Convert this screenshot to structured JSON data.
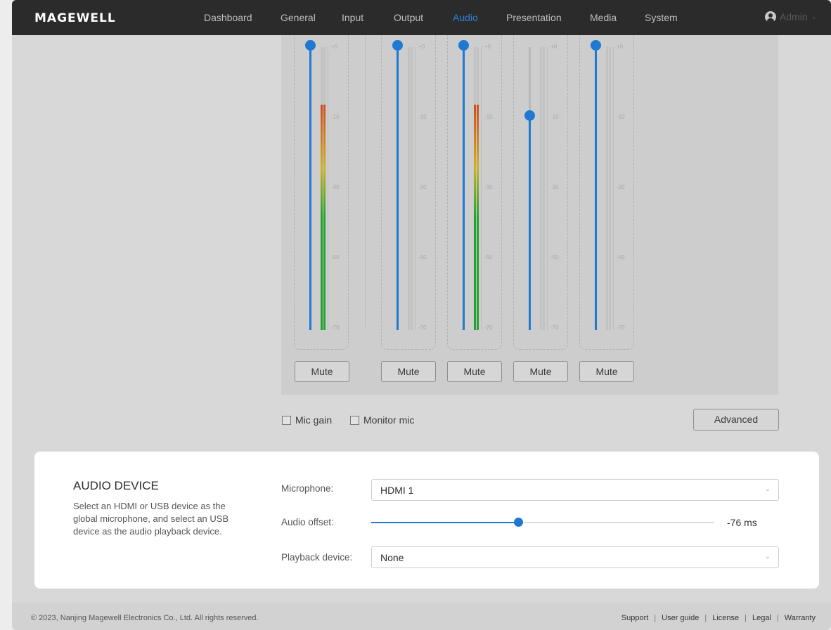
{
  "brand": {
    "logo_text": "MAGEWELL"
  },
  "nav": {
    "items": [
      {
        "label": "Dashboard"
      },
      {
        "label": "General"
      },
      {
        "label": "Input"
      },
      {
        "label": "Output"
      },
      {
        "label": "Audio",
        "active": true
      },
      {
        "label": "Presentation"
      },
      {
        "label": "Media"
      },
      {
        "label": "System"
      }
    ],
    "user": {
      "label": "Admin",
      "icon": "user-icon"
    }
  },
  "mixer": {
    "scale_labels": [
      "+0",
      "-10",
      "-30",
      "-50",
      "-70"
    ],
    "channels": [
      {
        "fader_level_db": 0,
        "meter_level_db": -10,
        "mute_label": "Mute"
      },
      {
        "fader_level_db": 0,
        "meter_level_db": null,
        "mute_label": "Mute"
      },
      {
        "fader_level_db": 0,
        "meter_level_db": -10,
        "mute_label": "Mute"
      },
      {
        "fader_level_db": -10,
        "meter_level_db": null,
        "mute_label": "Mute"
      },
      {
        "fader_level_db": 0,
        "meter_level_db": null,
        "mute_label": "Mute"
      }
    ],
    "mic_gain_label": "Mic gain",
    "mic_gain_checked": false,
    "monitor_mic_label": "Monitor mic",
    "monitor_mic_checked": false,
    "advanced_label": "Advanced"
  },
  "audio_device": {
    "title": "AUDIO DEVICE",
    "description": "Select an HDMI or USB device as the global microphone, and select an USB device as the audio playback device.",
    "microphone_label": "Microphone:",
    "microphone_value": "HDMI 1",
    "offset_label": "Audio offset:",
    "offset_value": "-76 ms",
    "offset_fraction": 0.43,
    "playback_label": "Playback device:",
    "playback_value": "None"
  },
  "footer": {
    "copyright": "© 2023, Nanjing Magewell Electronics Co., Ltd. All rights reserved.",
    "links": [
      "Support",
      "User guide",
      "License",
      "Legal",
      "Warranty"
    ]
  },
  "colors": {
    "accent": "#1f78d1",
    "topbar": "#2b2b2b",
    "meter_green": "#22a32f",
    "meter_red": "#d14a1f"
  }
}
